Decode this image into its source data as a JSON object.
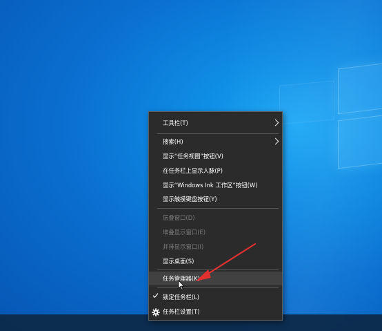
{
  "desktop": {
    "background_color": "#0a6fd0",
    "taskbar_color": "#0d2a4a"
  },
  "context_menu": {
    "items": [
      {
        "label": "工具栏(T)",
        "has_submenu": true,
        "disabled": false
      },
      {
        "label": "搜索(H)",
        "has_submenu": true,
        "disabled": false
      },
      {
        "label": "显示“任务视图”按钮(V)",
        "disabled": false
      },
      {
        "label": "在任务栏上显示人脉(P)",
        "disabled": false
      },
      {
        "label": "显示“Windows Ink 工作区”按钮(W)",
        "disabled": false
      },
      {
        "label": "显示触摸键盘按钮(Y)",
        "disabled": false
      },
      {
        "label": "层叠窗口(D)",
        "disabled": true
      },
      {
        "label": "堆叠显示窗口(E)",
        "disabled": true
      },
      {
        "label": "并排显示窗口(I)",
        "disabled": true
      },
      {
        "label": "显示桌面(S)",
        "disabled": false
      },
      {
        "label": "任务管理器(K)",
        "disabled": false,
        "highlighted": true
      },
      {
        "label": "锁定任务栏(L)",
        "checked": true,
        "disabled": false
      },
      {
        "label": "任务栏设置(T)",
        "icon": "gear-icon",
        "disabled": false
      }
    ]
  },
  "annotation": {
    "arrow_color": "#e03030",
    "icon": "red-arrow-icon"
  }
}
